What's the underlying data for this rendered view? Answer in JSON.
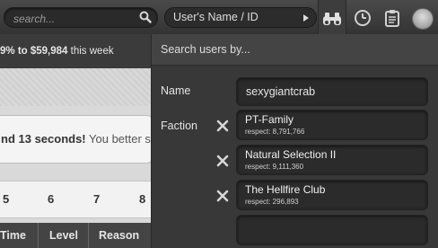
{
  "topbar": {
    "search_placeholder": "search...",
    "user_select_label": "User's Name / ID",
    "icons": [
      "search-icon",
      "binoculars-icon",
      "clock-icon",
      "clipboard-icon",
      "avatar"
    ]
  },
  "background": {
    "ticker_prefix": "9% to ",
    "ticker_amount": "$59,984",
    "ticker_suffix": " this week",
    "notice_bold": "nd 13 seconds!",
    "notice_text": " You better s",
    "pages": [
      "5",
      "6",
      "7",
      "8"
    ],
    "columns": [
      "Time",
      "Level",
      "Reason"
    ]
  },
  "panel": {
    "header": "Search users by...",
    "name_label": "Name",
    "name_value": "sexygiantcrab",
    "faction_label": "Faction",
    "factions": [
      {
        "name": "PT-Family",
        "respect": "respect: 8,791,766"
      },
      {
        "name": "Natural Selection II",
        "respect": "respect: 9,111,360"
      },
      {
        "name": "The Hellfire Club",
        "respect": "respect: 296,893"
      }
    ]
  }
}
